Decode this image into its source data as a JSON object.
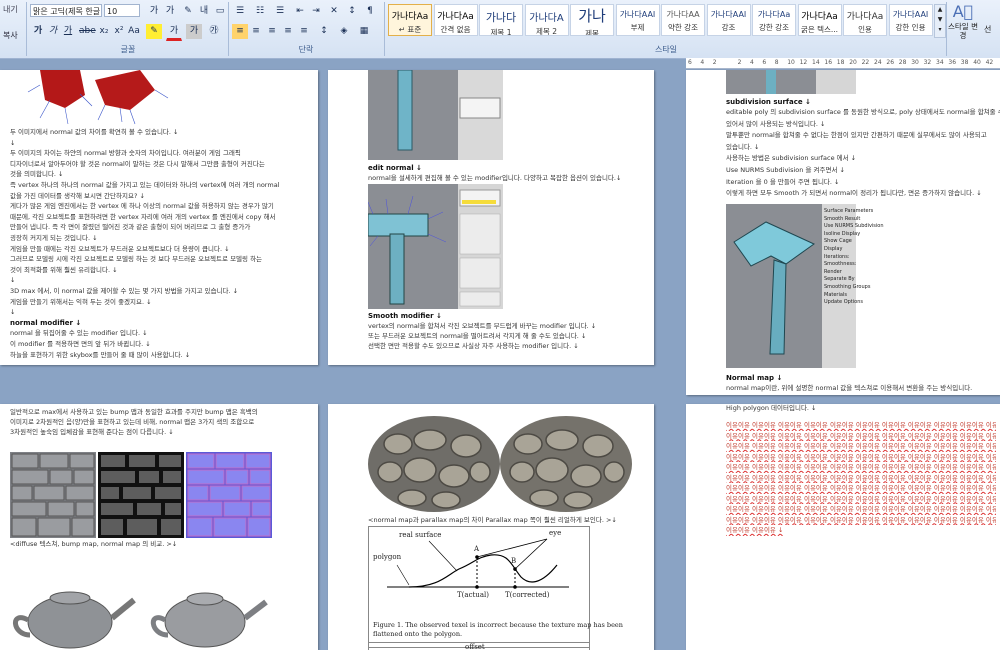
{
  "ribbon": {
    "left_edge_labels": [
      "내기",
      "복사"
    ],
    "font_name": "맑은 고딕(제목 한글",
    "font_size": "10",
    "group_font": "글꼴",
    "group_paragraph": "단락",
    "group_styles": "스타일",
    "styles": [
      {
        "sample": "가나다Aa",
        "name": "↵ 표준"
      },
      {
        "sample": "가나다Aa",
        "name": "간격 없음"
      },
      {
        "sample": "가나다",
        "name": "제목 1"
      },
      {
        "sample": "가나다A",
        "name": "제목 2"
      },
      {
        "sample": "가나",
        "name": "제목"
      },
      {
        "sample": "가나다AAI",
        "name": "부제"
      },
      {
        "sample": "가나다AA",
        "name": "약한 강조"
      },
      {
        "sample": "가나다AAI",
        "name": "강조"
      },
      {
        "sample": "가나다Aa",
        "name": "강한 강조"
      },
      {
        "sample": "가나다Aa",
        "name": "굵은 텍스..."
      },
      {
        "sample": "가나다Aa",
        "name": "인용"
      },
      {
        "sample": "가나다AAI",
        "name": "강한 인용"
      }
    ],
    "change_style_label": "스타일 변경",
    "right_cut": "선"
  },
  "ruler_ticks": [
    "6",
    "4",
    "2",
    "",
    "2",
    "4",
    "6",
    "8",
    "10",
    "12",
    "14",
    "16",
    "18",
    "20",
    "22",
    "24",
    "26",
    "28",
    "30",
    "32",
    "34",
    "36",
    "38",
    "40",
    "42"
  ],
  "page1": {
    "lines": [
      "두 이미지에서 normal 값의 차이를 확연히 볼 수 있습니다. ↓",
      "↓",
      "두 이미지의 차이는 하얀의 normal 방향과 숫자의 차이입니다. 여러분이 게임 그래픽",
      "디자이너로서 알아두어야 할 것은 normal이 말하는 것은 다시 말해서 그만큼 출형이 커진다는",
      "것을 의미합니다. ↓",
      "즉 vertex 하나의 하나의 normal 값을 가지고 있는 데이터와 하나의 vertex에 여러 개의 normal",
      "값을 가진 데이터를 생각해 보시면 간단하지요? ↓",
      "게다가 많은 게임 엔진에서는 한 vertex 에 하나 이상의 normal 값을 허용하지 않는 경우가 많기",
      "때문에, 각진 오브젝트를 표현하려면 한 vertex 자리에 여러 개의 vertex 를 엔진에서 copy 해서",
      "만들어 냅니다. 즉 각 면이 잘렸던 떨어진 것과 같은 출형이 되어 버리므로 그 출형 증가가",
      "굉장히 커지게 되는 것입니다. ↓",
      "게임을 만들 때에는 각진 오브젝트가 부드러운 오브젝트보다 더 용량이 큽니다. ↓",
      "그러므로 모델링 시에 각진 오브젝트로 모델링 하는 것 보다 부드러운 오브젝트로 모델링 하는",
      "것이 최적화를 위해 훨씬 유리합니다. ↓",
      "↓",
      "3D max 에서, 이 normal 값을 제어할 수 있는 몇 가지 방법을 가지고 있습니다. ↓",
      "게임을 만들기 위해서는 익혀 두는 것이 좋겠지요. ↓",
      "↓",
      "normal modifier ↓",
      "normal 을 뒤집어줄 수 있는 modifier 입니다. ↓",
      "이 modifier 를 적용하면 면의 앞 뒤가 바뀝니다. ↓",
      "하늘을 표현하기 위한 skybox를 만들어 줄 때 많이 사용합니다. ↓"
    ]
  },
  "page2": {
    "edit_normal_title": "edit normal ↓",
    "edit_normal_text": "normal을 설세하게 편집해 볼 수 있는 modifier입니다. 다양하고 복잡한 옵션이 있습니다.↓",
    "smooth_title": "Smooth modifier ↓",
    "smooth_lines": [
      "vertex의 normal을 합쳐서 각진 오브젝트를 부드럽게 바꾸는 modifier 입니다. ↓",
      "또는 부드러운 오브젝트의 normal을 떨어트려서 각지게 해 줄 수도 있습니다. ↓",
      "선택한 면만 적용할 수도 있으므로 사실상 자주 사용하는 modifier 입니다. ↓"
    ]
  },
  "page3": {
    "subdiv_title": "subdivision surface ↓",
    "lines": [
      "editable poly 의 subdivision surface 를 동원한 방식으로, poly 상태에서도 normal을 합쳐줄 수",
      "있어서 많이 사용되는 방식입니다. ↓",
      "말투뿐만 normal을 합쳐줄 수 없다는 한점이 있지만 간편하기 때문에 실무에서도 많이 사용되고",
      "있습니다. ↓",
      "사용하는 방법은 subdivision surface 에서 ↓",
      "Use NURMS Subdivision 을 켜주면서 ↓",
      "Iteration 을 0 을 만들어 주면 됩니다. ↓",
      "이렇게 하면 모두 Smooth 가 되면서 normal이 정리가 됩니다만, 면은 증가하지 않습니다. ↓"
    ],
    "normal_map_title": "Normal map ↓",
    "normal_map_text": "normal map이란, 위에 설명한 normal 값을 텍스쳐로 이용해서 변환을 주는 방식입니다.",
    "panel_items": [
      "Surface Parameters",
      "Smooth Result",
      "Use NURMS Subdivision",
      "Isoline Display",
      "Show Cage",
      "Display",
      "Iterations:",
      "Smoothness:",
      "Render",
      "Separate By",
      "Smoothing Groups",
      "Materials",
      "Update Options"
    ]
  },
  "page4": {
    "lines": [
      "일반적으로 max에서 사용하고 있는 bump 맵과 동일한 효과를 주지만 bump 맵은 흑백의",
      "이미지로 2차원적인 음(양)만을 표현하고 있는데 비해, normal 맵은 3가지 색의 조합으로",
      "3차원적인 높숙임 입체감을 표현해 준다는 점이 다릅니다. ↓"
    ],
    "caption": "<diffuse 텍스쳐, bump map, normal map 의 비교. >↓"
  },
  "page5": {
    "caption": "<normal map과 parallax map의 차이 Parallax map 쪽이 훨씬 리얼하게 보인다. >↓",
    "figure_labels": {
      "real_surface": "real surface",
      "polygon": "polygon",
      "eye": "eye",
      "A": "A",
      "B": "B",
      "t_actual": "T(actual)",
      "t_corrected": "T(corrected)"
    },
    "figure_caption_1": "Figure 1.  The observed texel is incorrect because the texture map has been",
    "figure_caption_2": "flattened onto the polygon.",
    "offset_label": "offset"
  },
  "page6": {
    "first_line": "High polygon  데이터입니다. ↓",
    "filler_word": "이유이유",
    "filler_rows": 11
  }
}
